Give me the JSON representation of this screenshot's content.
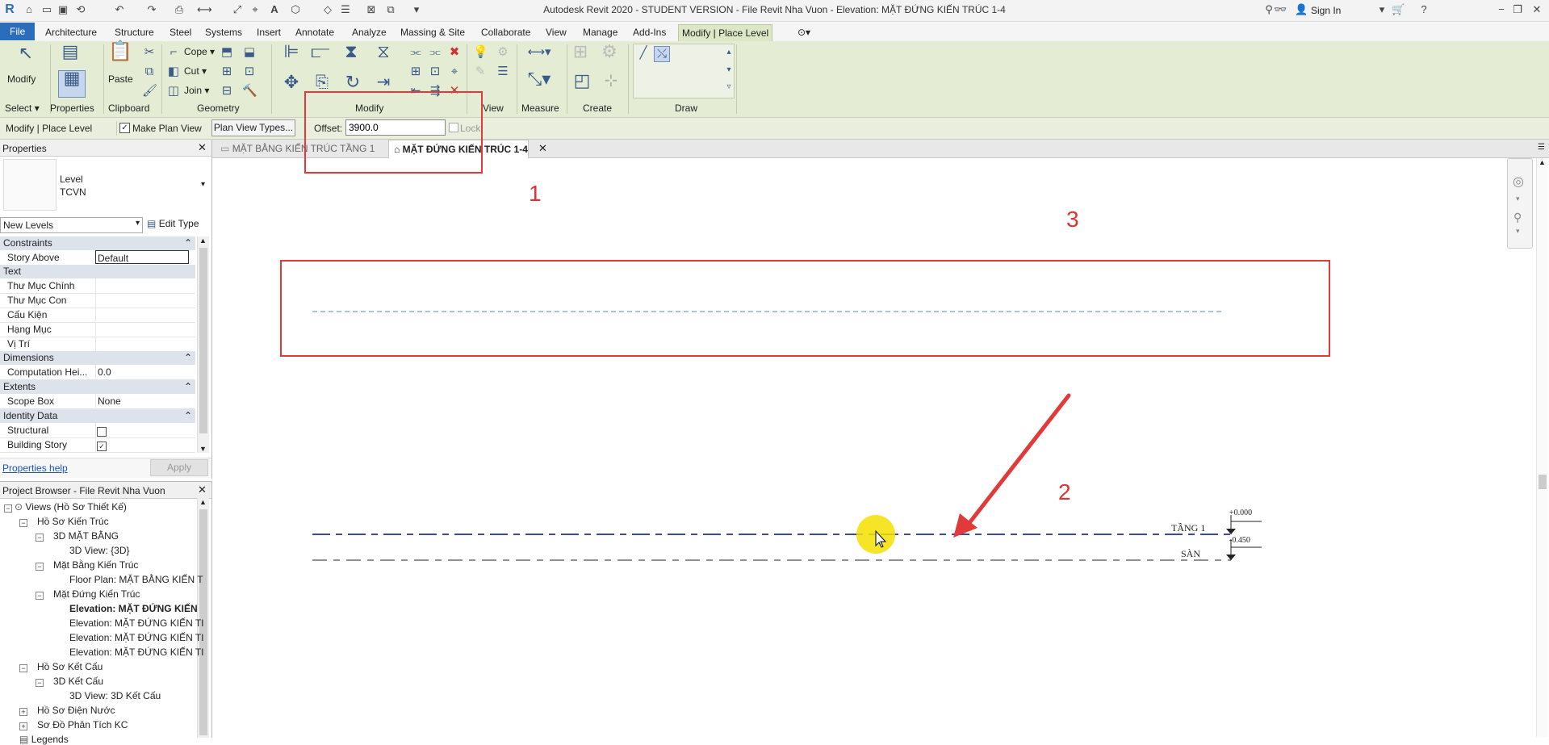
{
  "app": {
    "title": "Autodesk Revit 2020 - STUDENT VERSION - File Revit Nha Vuon - Elevation: MẶT ĐỨNG KIẾN TRÚC 1-4",
    "sign_in": "Sign In",
    "logo": "R"
  },
  "ribbon_tabs": [
    "File",
    "Architecture",
    "Structure",
    "Steel",
    "Systems",
    "Insert",
    "Annotate",
    "Analyze",
    "Massing & Site",
    "Collaborate",
    "View",
    "Manage",
    "Add-Ins",
    "Modify | Place Level"
  ],
  "ribbon": {
    "modify": "Modify",
    "paste": "Paste",
    "cope": "Cope",
    "cut": "Cut",
    "join": "Join",
    "panels": {
      "select": "Select",
      "properties": "Properties",
      "clipboard": "Clipboard",
      "geometry": "Geometry",
      "modify": "Modify",
      "view": "View",
      "measure": "Measure",
      "create": "Create",
      "draw": "Draw"
    }
  },
  "options_bar": {
    "context": "Modify | Place Level",
    "make_plan_view": "Make Plan View",
    "make_plan_view_checked": true,
    "plan_view_types": "Plan View Types...",
    "offset_label": "Offset:",
    "offset_value": "3900.0",
    "lock": "Lock"
  },
  "properties": {
    "header": "Properties",
    "type_family": "Level",
    "type_name": "TCVN",
    "filter": "New Levels",
    "edit_type": "Edit Type",
    "sections": [
      {
        "name": "Constraints",
        "rows": [
          {
            "k": "Story Above",
            "v": "Default"
          }
        ]
      },
      {
        "name": "Text",
        "rows": [
          {
            "k": "Thư Mục Chính",
            "v": ""
          },
          {
            "k": "Thư Mục Con",
            "v": ""
          },
          {
            "k": "Cấu Kiện",
            "v": ""
          },
          {
            "k": "Hạng Mục",
            "v": ""
          },
          {
            "k": "Vị Trí",
            "v": ""
          }
        ]
      },
      {
        "name": "Dimensions",
        "rows": [
          {
            "k": "Computation Hei...",
            "v": "0.0"
          }
        ]
      },
      {
        "name": "Extents",
        "rows": [
          {
            "k": "Scope Box",
            "v": "None"
          }
        ]
      },
      {
        "name": "Identity Data",
        "rows": [
          {
            "k": "Structural",
            "v": ""
          },
          {
            "k": "Building Story",
            "v": ""
          }
        ]
      }
    ],
    "structural_checked": false,
    "building_story_checked": true,
    "help": "Properties help",
    "apply": "Apply"
  },
  "project_browser": {
    "header": "Project Browser - File Revit Nha Vuon",
    "nodes": [
      {
        "label": "Views (Hồ Sơ Thiết Kế)",
        "toggle": "−"
      },
      {
        "label": "Hồ Sơ Kiến Trúc",
        "toggle": "−"
      },
      {
        "label": "3D MẶT BẰNG",
        "toggle": "−"
      },
      {
        "label": "3D View: {3D}",
        "toggle": ""
      },
      {
        "label": "Mặt Bằng Kiến Trúc",
        "toggle": "−"
      },
      {
        "label": "Floor Plan: MẶT BẰNG KIẾN T",
        "toggle": ""
      },
      {
        "label": "Mặt Đứng Kiến Trúc",
        "toggle": "−"
      },
      {
        "label": "Elevation: MẶT ĐỨNG KIẾN",
        "toggle": ""
      },
      {
        "label": "Elevation: MẶT ĐỨNG KIẾN TI",
        "toggle": ""
      },
      {
        "label": "Elevation: MẶT ĐỨNG KIẾN TI",
        "toggle": ""
      },
      {
        "label": "Elevation: MẶT ĐỨNG KIẾN TI",
        "toggle": ""
      },
      {
        "label": "Hồ Sơ Kết Cấu",
        "toggle": "−"
      },
      {
        "label": "3D Kết Cấu",
        "toggle": "−"
      },
      {
        "label": "3D View: 3D Kết Cấu",
        "toggle": ""
      },
      {
        "label": "Hồ Sơ Điện Nước",
        "toggle": "+"
      },
      {
        "label": "Sơ Đồ Phân Tích KC",
        "toggle": "+"
      },
      {
        "label": "Legends",
        "toggle": ""
      }
    ]
  },
  "view_tabs": [
    {
      "label": "MẶT BẰNG KIẾN TRÚC TẦNG 1",
      "active": false
    },
    {
      "label": "MẶT ĐỨNG KIẾN TRÚC 1-4",
      "active": true
    }
  ],
  "canvas": {
    "annotations": [
      "1",
      "2",
      "3"
    ],
    "level1_name": "TẦNG 1",
    "level1_elev": "+0.000",
    "level2_name": "SÀN",
    "level2_elev": "-0.450"
  },
  "colors": {
    "accent": "#2a6ebb",
    "ribbon_bg": "#e4ecd4",
    "callout": "#e23a3a",
    "level_line": "#3d4a9a"
  }
}
